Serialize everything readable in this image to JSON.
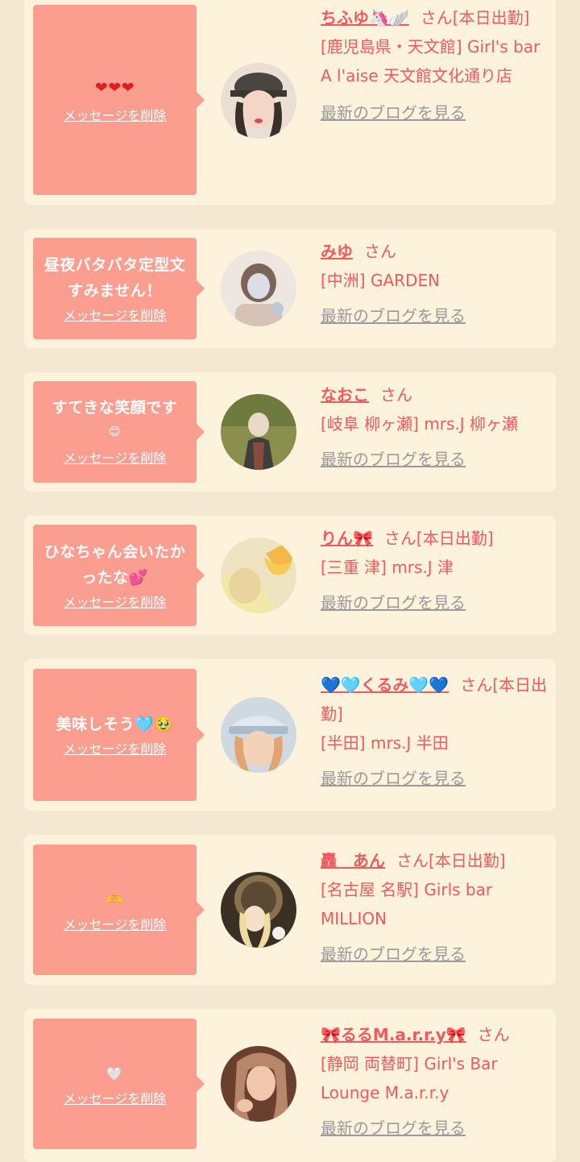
{
  "cards": [
    {
      "message": "",
      "message_emoji": "❤❤❤",
      "delete_label": "メッセージを削除",
      "name": "ちふゆ🦄🪽",
      "san": "さん[本日出勤]",
      "shop": "[鹿児島県・天文館] Girl's bar A l'aise 天文館文化通り店",
      "blog_label": "最新のブログを見る"
    },
    {
      "message": "昼夜バタバタ定型文すみません！",
      "message_emoji": "",
      "delete_label": "メッセージを削除",
      "name": "みゆ",
      "san": "さん",
      "shop": "[中洲] GARDEN",
      "blog_label": "最新のブログを見る"
    },
    {
      "message": "すてきな笑顔です",
      "message_emoji": "😊",
      "delete_label": "メッセージを削除",
      "name": "なおこ",
      "san": "さん",
      "shop": "[岐阜 柳ヶ瀬] mrs.J 柳ヶ瀬",
      "blog_label": "最新のブログを見る"
    },
    {
      "message": "ひなちゃん会いたかったな💕",
      "message_emoji": "",
      "delete_label": "メッセージを削除",
      "name": "りん🎀",
      "san": "さん[本日出勤]",
      "shop": "[三重 津] mrs.J 津",
      "blog_label": "最新のブログを見る"
    },
    {
      "message": "美味しそう🩵🥹",
      "message_emoji": "",
      "delete_label": "メッセージを削除",
      "name": "💙🩵くるみ🩵💙",
      "san": "さん[本日出勤]",
      "shop": "[半田] mrs.J 半田",
      "blog_label": "最新のブログを見る"
    },
    {
      "message": "",
      "message_emoji": "🫶",
      "delete_label": "メッセージを削除",
      "name": "轟　あん",
      "san": "さん[本日出勤]",
      "shop": "[名古屋 名駅] Girls bar MILLION",
      "blog_label": "最新のブログを見る"
    },
    {
      "message": "",
      "message_emoji": "🤍",
      "delete_label": "メッセージを削除",
      "name": "🎀るるM.a.r.r.y🎀",
      "san": "さん",
      "shop": "[静岡 両替町] Girl's Bar Lounge M.a.r.r.y",
      "blog_label": "最新のブログを見る"
    }
  ]
}
